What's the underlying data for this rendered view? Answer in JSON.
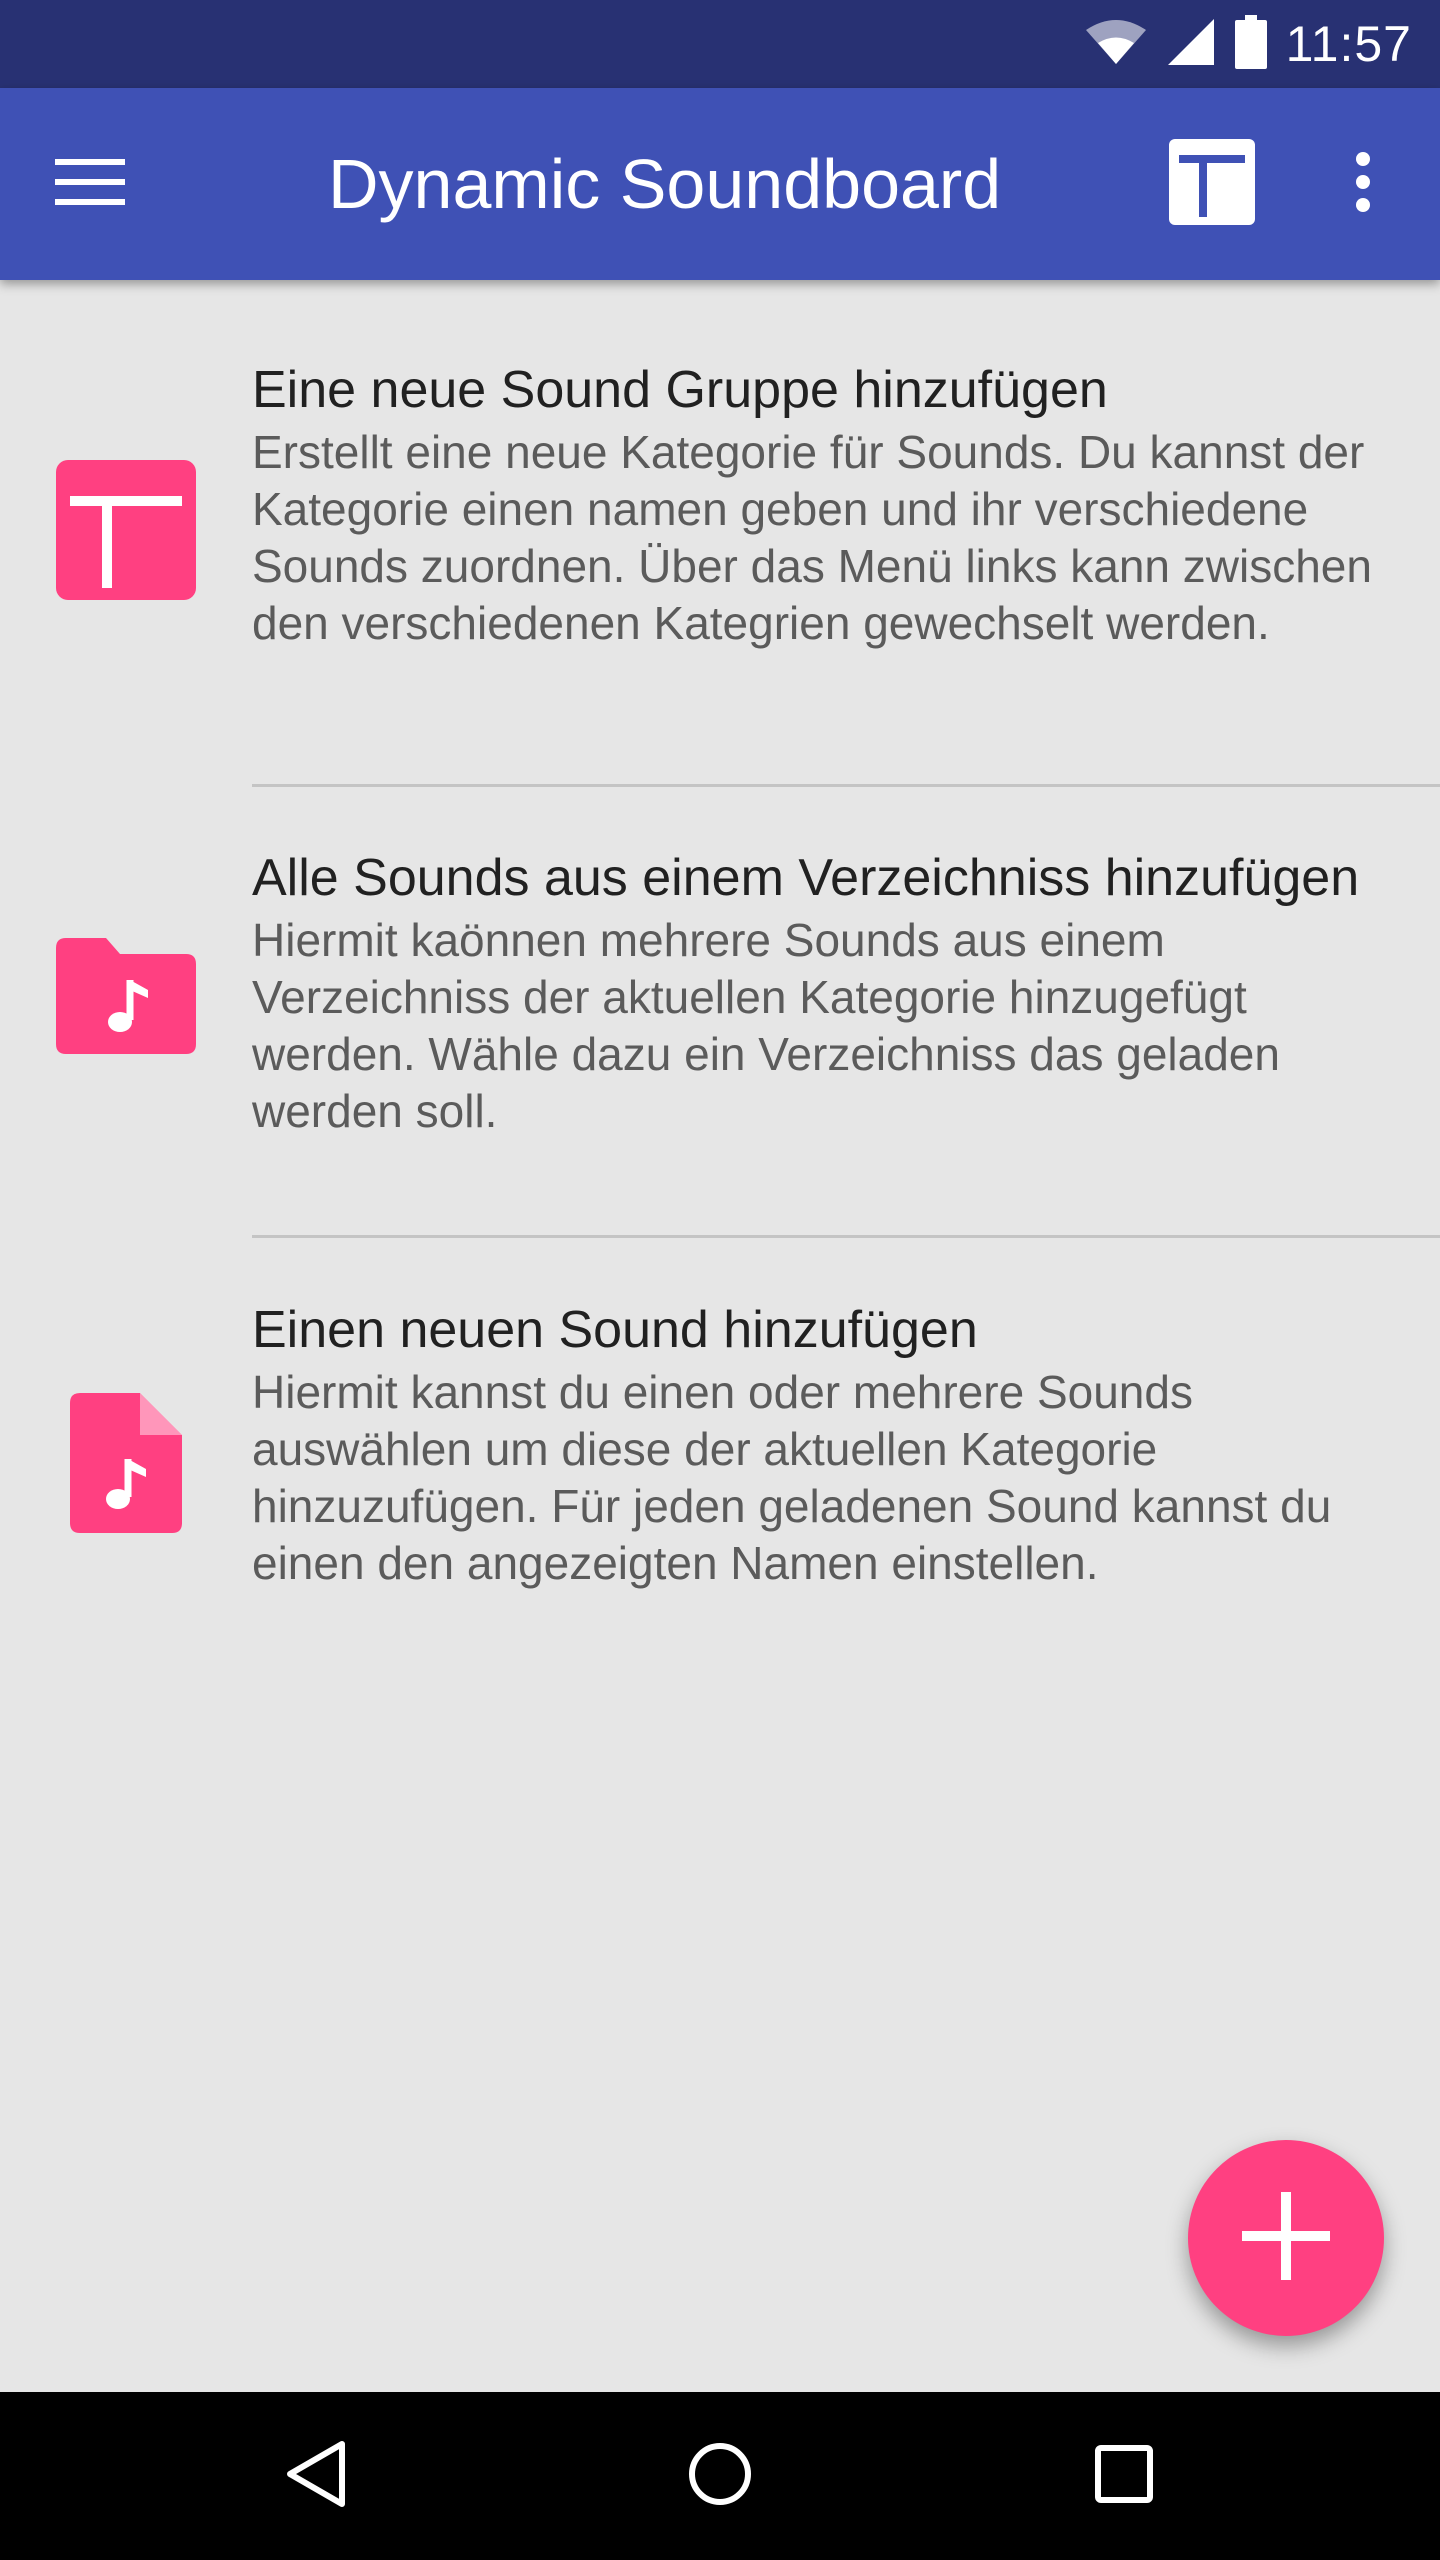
{
  "status_bar": {
    "time": "11:57",
    "icons": [
      "wifi-icon",
      "signal-icon",
      "battery-icon"
    ]
  },
  "app_bar": {
    "title": "Dynamic Soundboard",
    "menu_icon": "menu-icon",
    "add_group_icon": "add-group-icon",
    "overflow_icon": "more-vert-icon"
  },
  "items": [
    {
      "icon": "add-group-icon",
      "title": "Eine neue Sound Gruppe hinzufügen",
      "description": "Erstellt eine neue Kategorie für Sounds. Du kannst der Kategorie einen namen geben und ihr verschiedene Sounds zuordnen. Über das Menü links kann zwischen den verschiedenen Kategrien gewechselt werden."
    },
    {
      "icon": "music-folder-icon",
      "title": "Alle Sounds aus einem Verzeichniss hinzufügen",
      "description": "Hiermit kaönnen mehrere Sounds aus einem Verzeichniss der aktuellen Kategorie hinzugefügt werden. Wähle dazu ein Verzeichniss das geladen werden soll."
    },
    {
      "icon": "music-file-icon",
      "title": "Einen neuen Sound hinzufügen",
      "description": "Hiermit kannst du einen oder mehrere Sounds auswählen um diese der aktuellen Kategorie hinzuzufügen. Für jeden geladenen Sound kannst du einen den angezeigten Namen einstellen."
    }
  ],
  "fab": {
    "icon": "plus-icon"
  },
  "nav_bar": {
    "icons": [
      "back-icon",
      "home-icon",
      "recents-icon"
    ]
  },
  "colors": {
    "primary": "#3f51b5",
    "primary_dark": "#283173",
    "accent": "#ff4081",
    "background": "#e6e6e6"
  }
}
